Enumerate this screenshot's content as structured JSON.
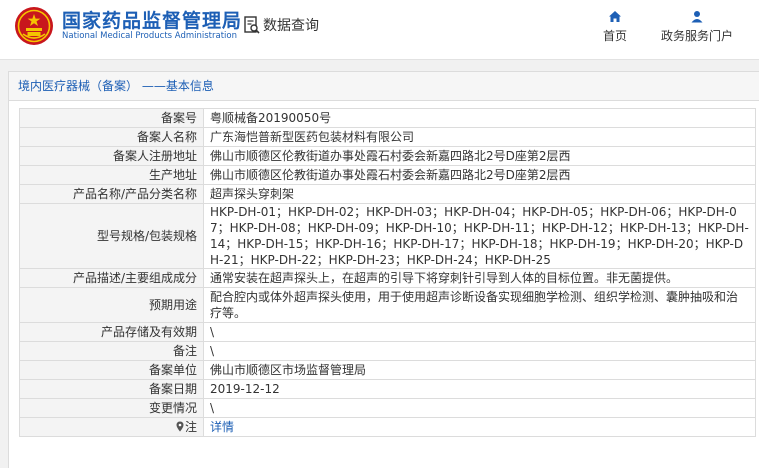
{
  "header": {
    "title": "国家药品监督管理局",
    "subtitle": "National Medical Products Administration",
    "query_label": "数据查询",
    "nav": [
      {
        "label": "首页",
        "icon": "home-icon"
      },
      {
        "label": "政务服务门户",
        "icon": "user-icon"
      }
    ]
  },
  "colors": {
    "brand": "#1d5fb5",
    "emblem": "#c8161d",
    "emblem_gold": "#f5c400"
  },
  "panel": {
    "title": "境内医疗器械（备案） ——基本信息",
    "rows": [
      {
        "label": "备案号",
        "value": "粤顺械备20190050号"
      },
      {
        "label": "备案人名称",
        "value": "广东海恺普新型医药包装材料有限公司"
      },
      {
        "label": "备案人注册地址",
        "value": "佛山市顺德区伦教街道办事处霞石村委会新嘉四路北2号D座第2层西"
      },
      {
        "label": "生产地址",
        "value": "佛山市顺德区伦教街道办事处霞石村委会新嘉四路北2号D座第2层西"
      },
      {
        "label": "产品名称/产品分类名称",
        "value": "超声探头穿刺架"
      },
      {
        "label": "型号规格/包装规格",
        "value": "HKP-DH-01；HKP-DH-02；HKP-DH-03；HKP-DH-04；HKP-DH-05；HKP-DH-06；HKP-DH-07；HKP-DH-08；HKP-DH-09；HKP-DH-10；HKP-DH-11；HKP-DH-12；HKP-DH-13；HKP-DH-14；HKP-DH-15；HKP-DH-16；HKP-DH-17；HKP-DH-18；HKP-DH-19；HKP-DH-20；HKP-DH-21；HKP-DH-22；HKP-DH-23；HKP-DH-24；HKP-DH-25"
      },
      {
        "label": "产品描述/主要组成成分",
        "value": "通常安装在超声探头上，在超声的引导下将穿刺针引导到人体的目标位置。非无菌提供。"
      },
      {
        "label": "预期用途",
        "value": "配合腔内或体外超声探头使用，用于使用超声诊断设备实现细胞学检测、组织学检测、囊肿抽吸和治疗等。"
      },
      {
        "label": "产品存储及有效期",
        "value": "\\"
      },
      {
        "label": "备注",
        "value": "\\"
      },
      {
        "label": "备案单位",
        "value": "佛山市顺德区市场监督管理局"
      },
      {
        "label": "备案日期",
        "value": "2019-12-12"
      },
      {
        "label": "变更情况",
        "value": "\\"
      },
      {
        "label": "注",
        "value": "详情"
      }
    ]
  }
}
